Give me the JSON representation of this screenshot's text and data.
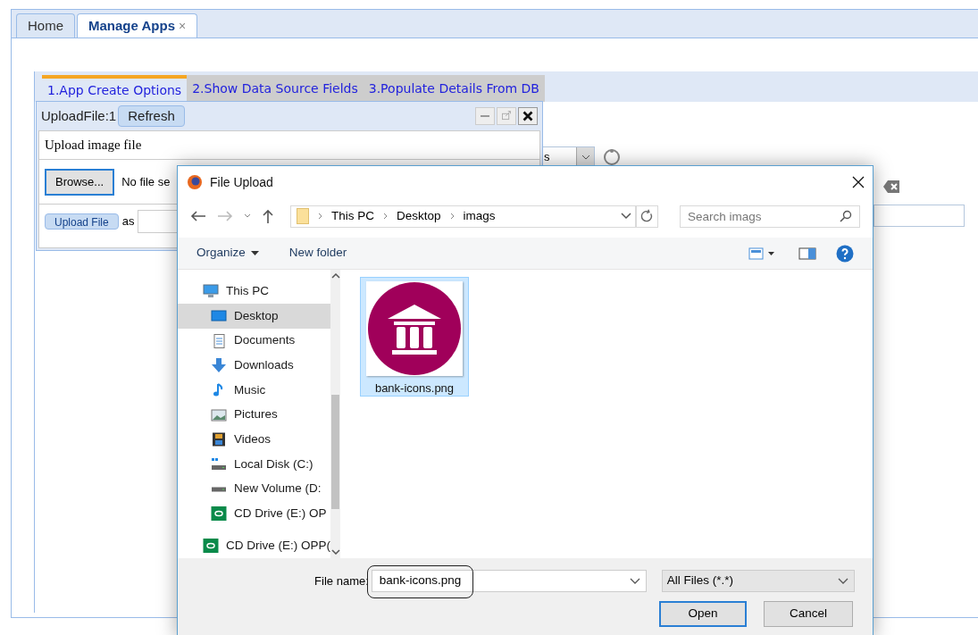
{
  "tabs": [
    {
      "label": "Home",
      "selected": false
    },
    {
      "label": "Manage Apps",
      "selected": true,
      "close_glyph": "×"
    }
  ],
  "wizard_steps": [
    {
      "label": "1.App Create Options",
      "selected": true
    },
    {
      "label": "2.Show Data Source Fields",
      "selected": false
    },
    {
      "label": "3.Populate Details From DB",
      "selected": false
    }
  ],
  "upload_panel": {
    "title": "UploadFile:1",
    "refresh_button": "Refresh",
    "heading": "Upload image file",
    "browse_button": "Browse...",
    "file_status": "No file se",
    "upload_button": "Upload File",
    "as_label": "as"
  },
  "background_form": {
    "dropdown_value": "s"
  },
  "dialog": {
    "title": "File Upload",
    "breadcrumb": [
      "This PC",
      "Desktop",
      "imags"
    ],
    "search_placeholder": "Search imags",
    "organize_menu": "Organize",
    "new_folder_button": "New folder",
    "nav_items": [
      {
        "label": "This PC",
        "kind": "pc",
        "selected": false,
        "children": [
          {
            "label": "Desktop",
            "kind": "desktop",
            "selected": true
          },
          {
            "label": "Documents",
            "kind": "documents",
            "selected": false
          },
          {
            "label": "Downloads",
            "kind": "downloads",
            "selected": false
          },
          {
            "label": "Music",
            "kind": "music",
            "selected": false
          },
          {
            "label": "Pictures",
            "kind": "pictures",
            "selected": false
          },
          {
            "label": "Videos",
            "kind": "videos",
            "selected": false
          },
          {
            "label": "Local Disk (C:)",
            "kind": "disk",
            "selected": false
          },
          {
            "label": "New Volume (D:",
            "kind": "drive",
            "selected": false
          },
          {
            "label": "CD Drive (E:) OP",
            "kind": "cd",
            "selected": false
          }
        ]
      },
      {
        "label": "CD Drive (E:) OPP(",
        "kind": "cd",
        "selected": false
      }
    ],
    "files": [
      {
        "name": "bank-icons.png",
        "selected": true
      }
    ],
    "file_name_label": "File name:",
    "file_name": "bank-icons.png",
    "file_name_highlighted": true,
    "file_type": "All Files (*.*)",
    "open_button": "Open",
    "cancel_button": "Cancel"
  }
}
